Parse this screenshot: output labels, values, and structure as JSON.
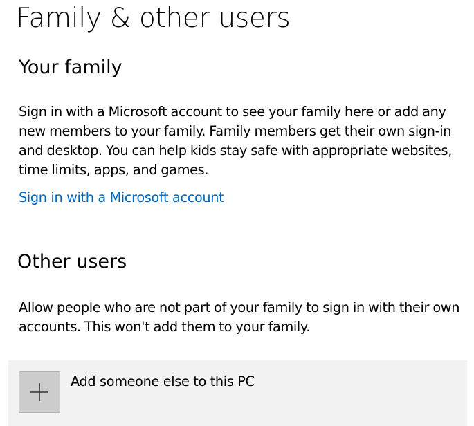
{
  "page": {
    "title": "Family & other users"
  },
  "family": {
    "title": "Your family",
    "description": "Sign in with a Microsoft account to see your family here or add any new members to your family. Family members get their own sign-in and desktop. You can help kids stay safe with appropriate websites, time limits, apps, and games.",
    "link_label": "Sign in with a Microsoft account"
  },
  "other_users": {
    "title": "Other users",
    "description": "Allow people who are not part of your family to sign in with their own accounts. This won't add them to your family.",
    "add_label": "Add someone else to this PC",
    "add_icon": "plus-icon"
  },
  "colors": {
    "link": "#0067c0",
    "card_background": "#f2f2f2",
    "tile_background": "#cccccc"
  }
}
